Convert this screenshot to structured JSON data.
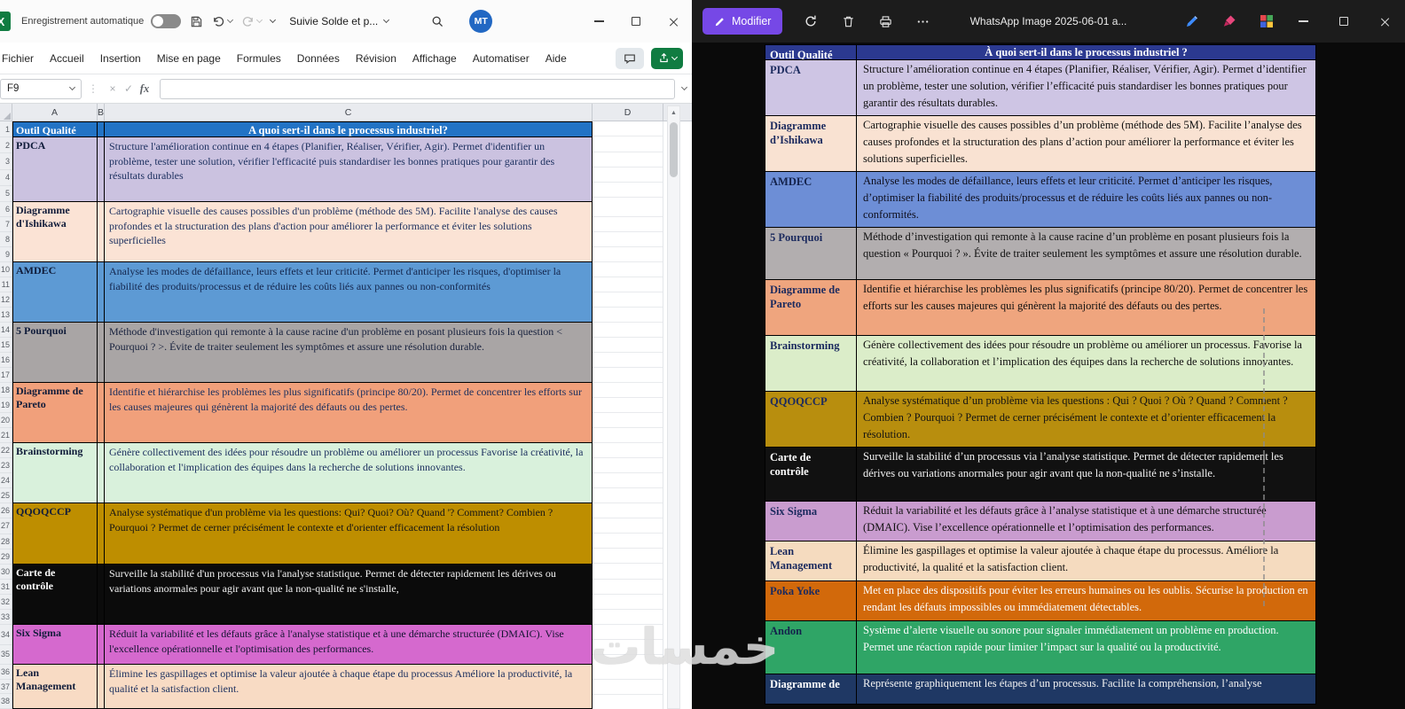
{
  "watermark": {
    "text": "خمسات"
  },
  "excel": {
    "titlebar": {
      "logo": "X",
      "autosave": "Enregistrement automatique",
      "filename": "Suivie Solde et p...",
      "avatar": "MT",
      "avatar_bg": "#2268C3"
    },
    "tabs": {
      "fichier": "Fichier",
      "accueil": "Accueil",
      "insertion": "Insertion",
      "mise_en_page": "Mise en page",
      "formules": "Formules",
      "donnees": "Données",
      "revision": "Révision",
      "affichage": "Affichage",
      "automatiser": "Automatiser",
      "aide": "Aide"
    },
    "ribbon": {
      "share_bg": "#107C41"
    },
    "formula": {
      "name_box": "F9",
      "dots": "⋮",
      "cancel": "×",
      "accept": "✓",
      "fx": "fx"
    },
    "columns": {
      "a": "A",
      "b": "B",
      "c": "C",
      "d": "D"
    },
    "scroll_up": "▲",
    "header": {
      "nums": [
        "1"
      ],
      "tool": "Outil Qualité",
      "question": "A quoi sert-il dans le processus industriel?",
      "bg": "#2273C5",
      "fg": "#FFFFFF"
    },
    "rows": [
      {
        "nums": [
          2,
          3,
          4,
          5
        ],
        "label": "PDCA",
        "bg": "#CBC2E0",
        "lfg": "#101C3A",
        "dfg": "#1B2F5E",
        "desc": "Structure l'amélioration continue en 4 étapes (Planifier, Réaliser, Vérifier, Agir). Permet d'identifier un problème, tester une solution, vérifier l'efficacité puis standardiser les bonnes pratiques pour garantir des résultats durables"
      },
      {
        "nums": [
          6,
          7,
          8,
          9
        ],
        "label": "Diagramme d'Ishikawa",
        "bg": "#FBE3D5",
        "lfg": "#101C3A",
        "dfg": "#1B2F5E",
        "desc": "Cartographie visuelle des causes possibles d'un problème (méthode des 5M). Facilite l'analyse des causes profondes et la structuration des plans d'action pour améliorer la performance et éviter les solutions superficielles"
      },
      {
        "nums": [
          10,
          11,
          12,
          13
        ],
        "label": "AMDEC",
        "bg": "#5D9AD4",
        "lfg": "#101C3A",
        "dfg": "#14264D",
        "desc": "Analyse les modes de défaillance, leurs effets et leur criticité. Permet d'anticiper les risques, d'optimiser la fiabilité des produits/processus et de réduire les coûts liés aux pannes ou non-conformités"
      },
      {
        "nums": [
          14,
          15,
          16,
          17
        ],
        "label": "5 Pourquoi",
        "bg": "#A9A5A5",
        "lfg": "#101C3A",
        "dfg": "#17213D",
        "desc": "Méthode d'investigation qui remonte à la cause racine d'un problème en posant plusieurs fois la question < Pourquoi ? >. Évite de traiter seulement les symptômes et assure une résolution durable."
      },
      {
        "nums": [
          18,
          19,
          20,
          21
        ],
        "label": "Diagramme de Pareto",
        "bg": "#F1A07B",
        "lfg": "#101C3A",
        "dfg": "#1B2F5E",
        "desc": "Identifie et hiérarchise les problèmes les plus significatifs (principe 80/20). Permet de concentrer les efforts sur les causes majeures qui génèrent la majorité des défauts ou des pertes."
      },
      {
        "nums": [
          22,
          23,
          24,
          25
        ],
        "label": "Brainstorming",
        "bg": "#D9F1DC",
        "lfg": "#101C3A",
        "dfg": "#1B2F5E",
        "desc": "Génère collectivement des idées pour résoudre un problème ou améliorer un processus Favorise la créativité, la collaboration et l'implication des équipes dans la recherche de solutions innovantes."
      },
      {
        "nums": [
          26,
          27,
          28,
          29
        ],
        "label": "QQOQCCP",
        "bg": "#BE8E00",
        "lfg": "#101C3A",
        "dfg": "#141414",
        "desc": "Analyse systématique d'un problème via les questions: Qui? Quoi? Où? Quand '? Comment? Combien ? Pourquoi ? Permet de cerner précisément le contexte et d'orienter efficacement la résolution"
      },
      {
        "nums": [
          30,
          31,
          32,
          33
        ],
        "label": "Carte de contrôle",
        "bg": "#0B0B0B",
        "lfg": "#FFFFFF",
        "dfg": "#F2F2F2",
        "desc": "Surveille la stabilité d'un processus via l'analyse statistique. Permet de détecter rapidement les dérives ou variations anormales pour agir avant que la non-qualité ne s'installe,"
      },
      {
        "nums": [
          34,
          35
        ],
        "label": "Six Sigma",
        "bg": "#D569CE",
        "lfg": "#101C3A",
        "dfg": "#141431",
        "desc": "Réduit la variabilité et les défauts grâce à l'analyse statistique et à une démarche structurée (DMAIC). Vise l'excellence opérationnelle et l'optimisation des performances."
      },
      {
        "nums": [
          36,
          37,
          38
        ],
        "label": "Lean Management",
        "bg": "#F8DBC4",
        "lfg": "#101C3A",
        "dfg": "#1B2F5E",
        "desc": "Élimine les gaspillages et optimise la valeur ajoutée à chaque étape du processus Améliore la productivité, la qualité et la satisfaction client."
      }
    ]
  },
  "photos": {
    "toolbar": {
      "edit": "Modifier",
      "edit_bg": "#7648E6",
      "title": "WhatsApp Image 2025-06-01 a..."
    },
    "table": {
      "header": {
        "tool": "Outil Qualité",
        "question": "À quoi sert-il dans le processus industriel ?",
        "bg": "#2B3990",
        "fg": "#FFFFFF"
      },
      "rows": [
        {
          "label": "PDCA",
          "bg": "#CEC5E4",
          "lfg": "#1B2A5E",
          "dfg": "#101010",
          "desc": "Structure l’amélioration continue en 4 étapes (Planifier, Réaliser, Vérifier, Agir). Permet d’identifier un problème, tester une solution, vérifier l’efficacité puis standardiser les bonnes pratiques pour garantir des résultats durables."
        },
        {
          "label": "Diagramme d’Ishikawa",
          "bg": "#F9E2D2",
          "lfg": "#1B2A5E",
          "dfg": "#101010",
          "desc": "Cartographie visuelle des causes possibles d’un problème (méthode des 5M). Facilite l’analyse des causes profondes et la structuration des plans d’action pour améliorer la performance et éviter les solutions superficielles."
        },
        {
          "label": "AMDEC",
          "bg": "#6D8ED6",
          "lfg": "#14234C",
          "dfg": "#0E0E1C",
          "desc": "Analyse les modes de défaillance, leurs effets et leur criticité. Permet d’anticiper les risques, d’optimiser la fiabilité des produits/processus et de réduire les coûts liés aux pannes ou non-conformités."
        },
        {
          "label": "5 Pourquoi",
          "bg": "#B2AEAF",
          "lfg": "#1B2A5E",
          "dfg": "#101010",
          "desc": "Méthode d’investigation qui remonte à la cause racine d’un problème en posant plusieurs fois la question « Pourquoi ? ». Évite de traiter seulement les symptômes et assure une résolution durable."
        },
        {
          "label": "Diagramme de Pareto",
          "bg": "#EFA57E",
          "lfg": "#1B2A5E",
          "dfg": "#101010",
          "desc": "Identifie et hiérarchise les problèmes les plus significatifs (principe 80/20). Permet de concentrer les efforts sur les causes majeures qui génèrent la majorité des défauts ou des pertes."
        },
        {
          "label": "Brainstorming",
          "bg": "#DBEDC9",
          "lfg": "#1B2A5E",
          "dfg": "#101010",
          "desc": "Génère collectivement des idées pour résoudre un problème ou améliorer un processus. Favorise la créativité, la collaboration et l’implication des équipes dans la recherche de solutions innovantes."
        },
        {
          "label": "QQOQCCP",
          "bg": "#B88E0E",
          "lfg": "#1B2A5E",
          "dfg": "#131313",
          "desc": "Analyse systématique d’un problème via les questions : Qui ? Quoi ? Où ? Quand ? Comment ? Combien ? Pourquoi ? Permet de cerner précisément le contexte et d’orienter efficacement la résolution."
        },
        {
          "label": "Carte de contrôle",
          "bg": "#111111",
          "lfg": "#FFFFFF",
          "dfg": "#F2F2F2",
          "desc": "Surveille la stabilité d’un processus via l’analyse statistique. Permet de détecter rapidement les dérives ou variations anormales pour agir avant que la non-qualité ne s’installe."
        },
        {
          "label": "Six Sigma",
          "bg": "#C99CCF",
          "lfg": "#1B2A5E",
          "dfg": "#101010",
          "desc": "Réduit la variabilité et les défauts grâce à l’analyse statistique et à une démarche structurée (DMAIC). Vise l’excellence opérationnelle et l’optimisation des performances."
        },
        {
          "label": "Lean Management",
          "bg": "#F5DBBF",
          "lfg": "#1B2A5E",
          "dfg": "#101010",
          "desc": "Élimine les gaspillages et optimise la valeur ajoutée à chaque étape du processus. Améliore la productivité, la qualité et la satisfaction client."
        },
        {
          "label": "Poka Yoke",
          "bg": "#D2690B",
          "lfg": "#1B2A5E",
          "dfg": "#FDFDFD",
          "desc": "Met en place des dispositifs pour éviter les erreurs humaines ou les oublis. Sécurise la production en rendant les défauts impossibles ou immédiatement détectables."
        },
        {
          "label": "Andon",
          "bg": "#2FA566",
          "lfg": "#14234C",
          "dfg": "#FDFDFD",
          "desc": "Système d’alerte visuelle ou sonore pour signaler immédiatement un problème en production. Permet une réaction rapide pour limiter l’impact sur la qualité ou la productivité."
        },
        {
          "label": "Diagramme de",
          "bg": "#1F3864",
          "lfg": "#FFFFFF",
          "dfg": "#F2F2F2",
          "desc": "Représente graphiquement les étapes d’un processus. Facilite la compréhension, l’analyse"
        }
      ]
    }
  }
}
